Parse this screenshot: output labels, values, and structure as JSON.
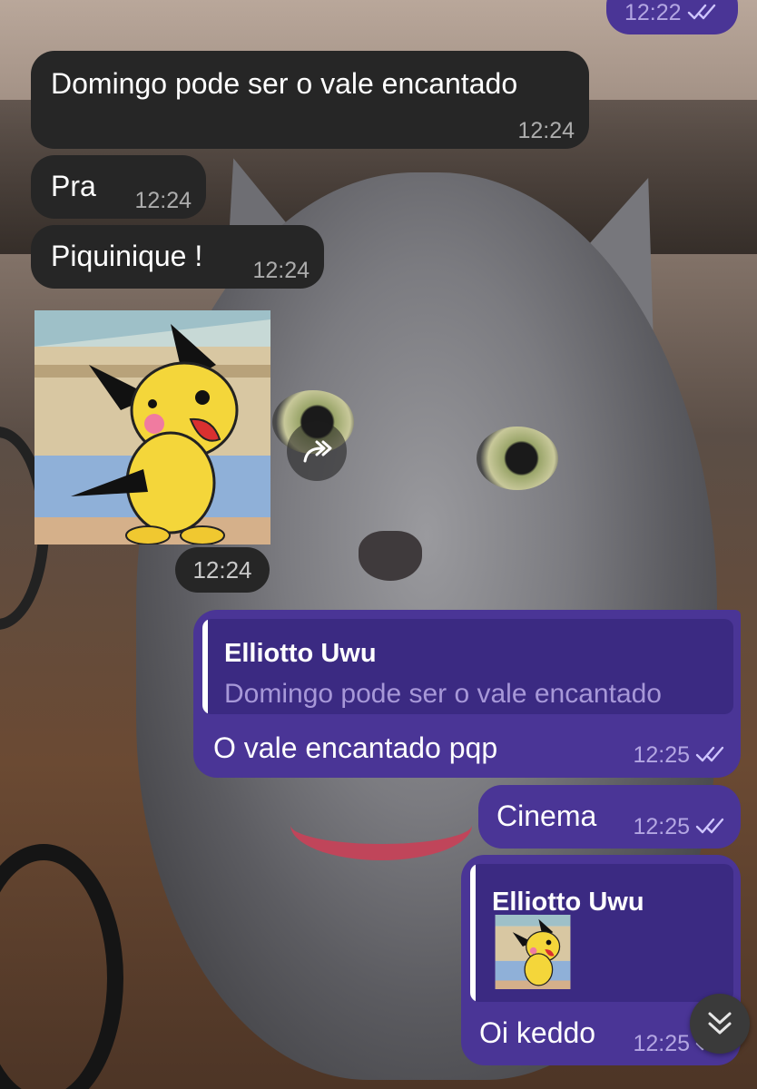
{
  "messages": [
    {
      "id": "m0",
      "direction": "outgoing",
      "time": "12:22",
      "status": "read",
      "partial": true
    },
    {
      "id": "m1",
      "direction": "incoming",
      "text": "Domingo pode ser o vale encantado",
      "time": "12:24"
    },
    {
      "id": "m2",
      "direction": "incoming",
      "text": "Pra",
      "time": "12:24"
    },
    {
      "id": "m3",
      "direction": "incoming",
      "text": "Piquinique !",
      "time": "12:24"
    },
    {
      "id": "m4",
      "direction": "incoming",
      "type": "sticker",
      "sticker_subject": "Pichu",
      "time": "12:24"
    },
    {
      "id": "m5",
      "direction": "outgoing",
      "reply_to": {
        "name": "Elliotto Uwu",
        "text": "Domingo pode ser o vale encantado"
      },
      "text": "O vale encantado pqp",
      "time": "12:25",
      "status": "read"
    },
    {
      "id": "m6",
      "direction": "outgoing",
      "text": "Cinema",
      "time": "12:25",
      "status": "read"
    },
    {
      "id": "m7",
      "direction": "outgoing",
      "reply_to": {
        "name": "Elliotto Uwu",
        "type": "sticker"
      },
      "text": "Oi keddo",
      "time": "12:25",
      "status": "read"
    }
  ],
  "icons": {
    "share": "forward-arrow-icon",
    "scroll": "double-chevron-down-icon",
    "read": "double-check-icon"
  },
  "colors": {
    "incoming_bubble": "#262626",
    "outgoing_bubble": "#4a3596",
    "reply_box": "#3b2a82"
  }
}
